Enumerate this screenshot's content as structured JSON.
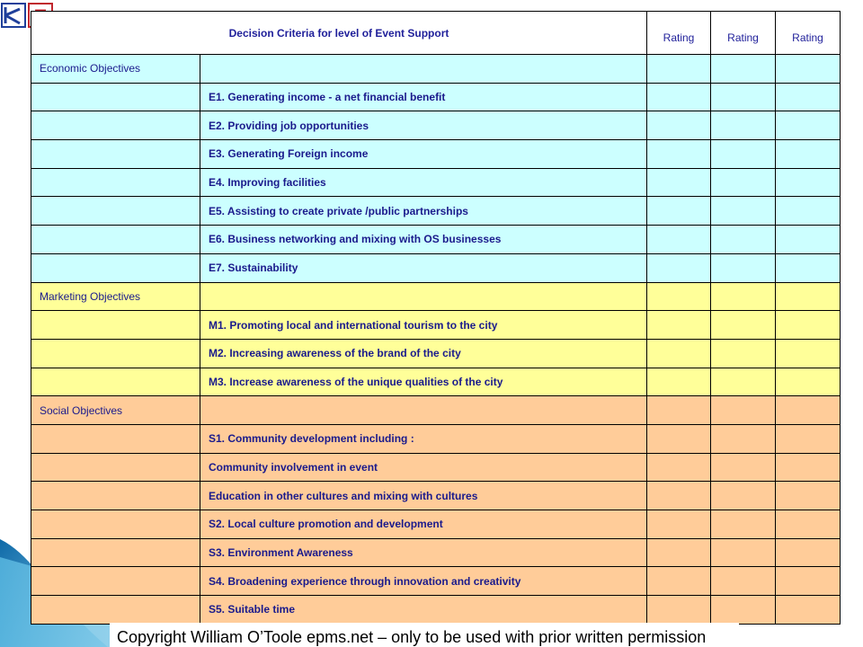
{
  "header": {
    "title": "Decision Criteria for level of Event Support",
    "rating_labels": [
      "Rating",
      "Rating",
      "Rating"
    ]
  },
  "groups": {
    "economic": {
      "label": "Economic Objectives",
      "color": "#ccffff",
      "items": [
        "E1. Generating income  - a net financial benefit",
        "E2. Providing job opportunities",
        "E3. Generating Foreign income",
        "E4. Improving facilities",
        "E5. Assisting to create private /public partnerships",
        "E6. Business networking and mixing with OS businesses",
        "E7. Sustainability"
      ]
    },
    "marketing": {
      "label": "Marketing Objectives",
      "color": "#ffff99",
      "items": [
        "M1. Promoting local and international tourism to the city",
        "M2. Increasing awareness of the brand of the city",
        "M3. Increase awareness of the unique qualities of the city"
      ]
    },
    "social": {
      "label": "Social Objectives",
      "color": "#ffcc99",
      "items": [
        "S1. Community development including :",
        "Community involvement in event",
        "Education in other cultures and mixing with cultures",
        "S2. Local culture promotion and  development",
        "S3. Environment Awareness",
        "S4. Broadening experience through innovation and creativity",
        "S5.  Suitable time"
      ]
    }
  },
  "footer": {
    "copyright": "Copyright William O’Toole epms.net – only to be used with prior written permission"
  },
  "logo": {
    "text": "E"
  }
}
